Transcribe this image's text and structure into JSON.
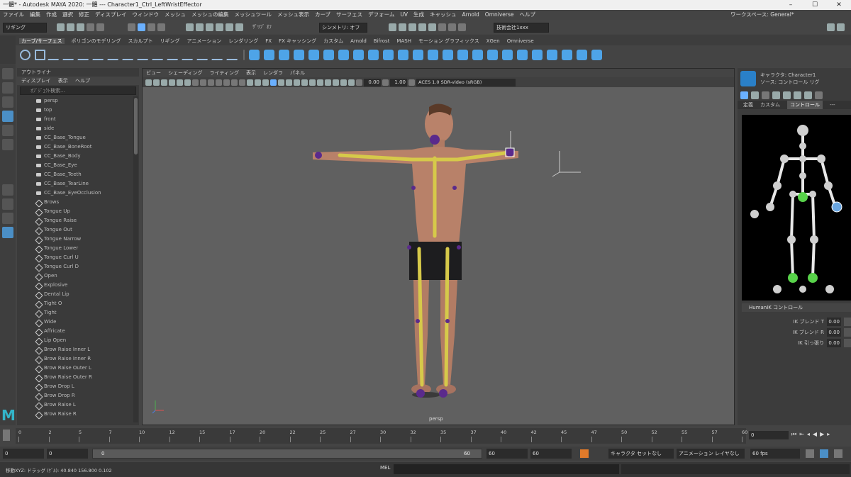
{
  "window": {
    "title": "一體* - Autodesk MAYA 2020: 一體  ---  Character1_Ctrl_LeftWristEffector",
    "controls": [
      "–",
      "☐",
      "✕"
    ]
  },
  "menubar": [
    "ファイル",
    "編集",
    "作成",
    "選択",
    "修正",
    "ディスプレイ",
    "ウィンドウ",
    "メッシュ",
    "メッシュの編集",
    "メッシュツール",
    "メッシュ表示",
    "カーブ",
    "サーフェス",
    "デフォーム",
    "UV",
    "生成",
    "キャッシュ",
    "Arnold",
    "Omniverse",
    "ヘルプ"
  ],
  "workspace": {
    "label": "ワークスペース:",
    "value": "General*"
  },
  "statusline": {
    "mode": "リギング",
    "symmetry": "シンメトリ: オフ",
    "no_live": "ｻﾞﾘﾌﾞ ｵﾌ",
    "login": "技術会社1xxx"
  },
  "shelf_tabs": [
    "カーブ/サーフェス",
    "ポリゴンのモデリング",
    "スカルプト",
    "リギング",
    "アニメーション",
    "レンダリング",
    "FX",
    "FX キャッシング",
    "カスタム",
    "Arnold",
    "Bifrost",
    "MASH",
    "モーション グラフィックス",
    "XGen",
    "Omniverse"
  ],
  "shelf_active": "カーブ/サーフェス",
  "outliner": {
    "menu": [
      "ディスプレイ",
      "表示",
      "ヘルプ"
    ],
    "title": "アウトライナ",
    "search_placeholder": "ｵﾌﾞｼﾞｪｸﾄ検索...",
    "items": [
      {
        "label": "persp",
        "type": "camera"
      },
      {
        "label": "top",
        "type": "camera"
      },
      {
        "label": "front",
        "type": "camera"
      },
      {
        "label": "side",
        "type": "camera"
      },
      {
        "label": "CC_Base_Tongue",
        "type": "mesh"
      },
      {
        "label": "CC_Base_BoneRoot",
        "type": "mesh"
      },
      {
        "label": "CC_Base_Body",
        "type": "mesh"
      },
      {
        "label": "CC_Base_Eye",
        "type": "mesh"
      },
      {
        "label": "CC_Base_Teeth",
        "type": "mesh"
      },
      {
        "label": "CC_Base_TearLine",
        "type": "mesh"
      },
      {
        "label": "CC_Base_EyeOcclusion",
        "type": "mesh"
      },
      {
        "label": "Brows",
        "type": "bone"
      },
      {
        "label": "Tongue Up",
        "type": "bone"
      },
      {
        "label": "Tongue Raise",
        "type": "bone"
      },
      {
        "label": "Tongue Out",
        "type": "bone"
      },
      {
        "label": "Tongue Narrow",
        "type": "bone"
      },
      {
        "label": "Tongue Lower",
        "type": "bone"
      },
      {
        "label": "Tongue Curl U",
        "type": "bone"
      },
      {
        "label": "Tongue Curl D",
        "type": "bone"
      },
      {
        "label": "Open",
        "type": "bone"
      },
      {
        "label": "Explosive",
        "type": "bone"
      },
      {
        "label": "Dental Lip",
        "type": "bone"
      },
      {
        "label": "Tight O",
        "type": "bone"
      },
      {
        "label": "Tight",
        "type": "bone"
      },
      {
        "label": "Wide",
        "type": "bone"
      },
      {
        "label": "Affricate",
        "type": "bone"
      },
      {
        "label": "Lip Open",
        "type": "bone"
      },
      {
        "label": "Brow Raise Inner L",
        "type": "bone"
      },
      {
        "label": "Brow Raise Inner R",
        "type": "bone"
      },
      {
        "label": "Brow Raise Outer L",
        "type": "bone"
      },
      {
        "label": "Brow Raise Outer R",
        "type": "bone"
      },
      {
        "label": "Brow Drop L",
        "type": "bone"
      },
      {
        "label": "Brow Drop R",
        "type": "bone"
      },
      {
        "label": "Brow Raise L",
        "type": "bone"
      },
      {
        "label": "Brow Raise R",
        "type": "bone"
      }
    ]
  },
  "viewport": {
    "menu": [
      "ビュー",
      "シェーディング",
      "ライティング",
      "表示",
      "レンダラ",
      "パネル"
    ],
    "exposure": "0.00",
    "gamma": "1.00",
    "colorspace": "ACES 1.0 SDR-video (sRGB)",
    "camera_label": "persp"
  },
  "humanik": {
    "character_label": "キャラクタ:",
    "character_value": "Character1",
    "source_label": "ソース:",
    "source_value": "コントロール リグ",
    "tabs": [
      "定義",
      "カスタム",
      "コントロール",
      "---"
    ],
    "active_tab": "コントロール",
    "controls_header": "HumanIK コントロール",
    "rows": [
      {
        "label": "IK ブレンド T",
        "value": "0.00"
      },
      {
        "label": "IK ブレンド R",
        "value": "0.00"
      },
      {
        "label": "IK 引っ張り",
        "value": "0.00"
      }
    ]
  },
  "timeline": {
    "ticks": [
      "0",
      "2",
      "5",
      "7",
      "10",
      "12",
      "15",
      "17",
      "20",
      "22",
      "25",
      "27",
      "30",
      "32",
      "35",
      "37",
      "40",
      "42",
      "45",
      "47",
      "50",
      "52",
      "55",
      "57",
      "60"
    ],
    "current_frame": "0"
  },
  "range": {
    "start": "0",
    "anim_start": "0",
    "range_start_label": "0",
    "range_end_label": "60",
    "anim_end": "60",
    "end": "60",
    "character": "キャラクタ セットなし",
    "anim_layer": "アニメーション レイヤなし",
    "fps": "60 fps"
  },
  "cmdline": {
    "help": "移動XYZ: ドラッグ (ｹﾞﾙ):   40.840   156.800   0.102",
    "mel": "MEL"
  }
}
